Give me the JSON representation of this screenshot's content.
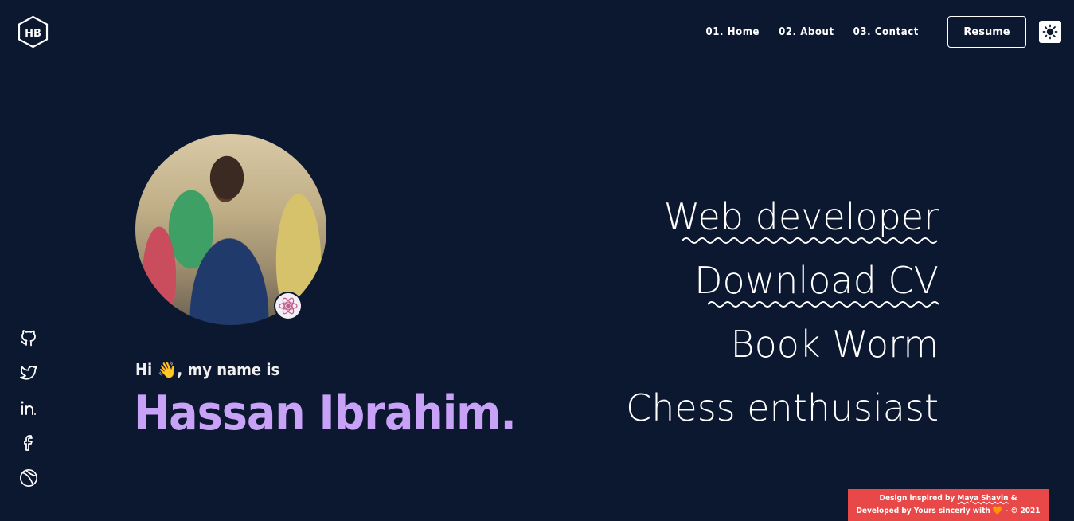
{
  "logo": {
    "initials": "HB",
    "icon": "hexagon-logo-icon"
  },
  "nav": {
    "links": [
      "01. Home",
      "02. About",
      "03. Contact"
    ],
    "resume_label": "Resume",
    "theme_icon": "sun-icon"
  },
  "social": {
    "icons": [
      "github-icon",
      "twitter-icon",
      "linkedin-icon",
      "facebook-icon",
      "dev-icon"
    ]
  },
  "hero": {
    "greeting_prefix": "Hi ",
    "greeting_emoji": "👋",
    "greeting_suffix": ", my name is",
    "name": "Hassan Ibrahim."
  },
  "roles": [
    {
      "label": "Web developer",
      "link": true
    },
    {
      "label": "Download CV",
      "link": true
    },
    {
      "label": "Book Worm",
      "link": false
    },
    {
      "label": "Chess enthusiast",
      "link": false
    }
  ],
  "credit": {
    "line1_prefix": "Design inspired by ",
    "author": "Maya Shavin",
    "line1_suffix": " &",
    "line2_prefix": "Developed by Yours sincerly with ",
    "heart": "🧡",
    "line2_suffix": " - © 2021"
  },
  "colors": {
    "background": "#0c1730",
    "name_accent": "#c8a2f7",
    "credit_bg": "#e94848"
  }
}
